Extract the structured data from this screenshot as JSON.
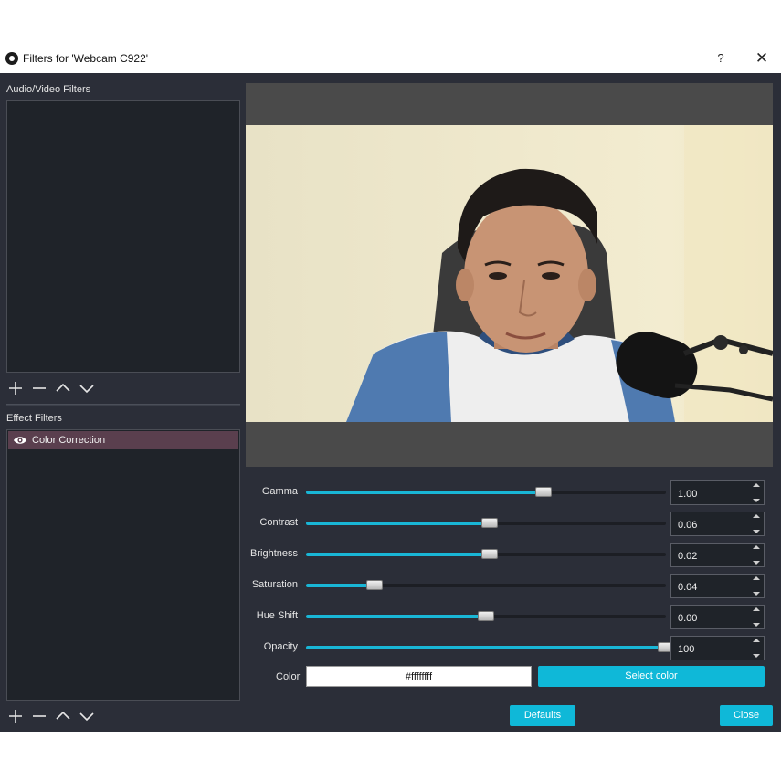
{
  "window": {
    "title": "Filters for 'Webcam C922'",
    "help_label": "?",
    "close_label": "✕"
  },
  "audio_video": {
    "heading": "Audio/Video Filters",
    "items": []
  },
  "effect": {
    "heading": "Effect Filters",
    "items": [
      {
        "label": "Color Correction",
        "visible": true
      }
    ]
  },
  "properties": {
    "gamma": {
      "label": "Gamma",
      "value": "1.00",
      "fraction": 0.66
    },
    "contrast": {
      "label": "Contrast",
      "value": "0.06",
      "fraction": 0.51
    },
    "brightness": {
      "label": "Brightness",
      "value": "0.02",
      "fraction": 0.51
    },
    "saturation": {
      "label": "Saturation",
      "value": "0.04",
      "fraction": 0.19
    },
    "hue_shift": {
      "label": "Hue Shift",
      "value": "0.00",
      "fraction": 0.5
    },
    "opacity": {
      "label": "Opacity",
      "value": "100",
      "fraction": 1.0
    },
    "color": {
      "label": "Color",
      "value": "#ffffffff",
      "button": "Select color"
    }
  },
  "footer": {
    "defaults_label": "Defaults",
    "close_label": "Close"
  },
  "colors": {
    "accent": "#19b6d6",
    "background": "#2b2e38",
    "selected_item": "#5a3f4e"
  }
}
